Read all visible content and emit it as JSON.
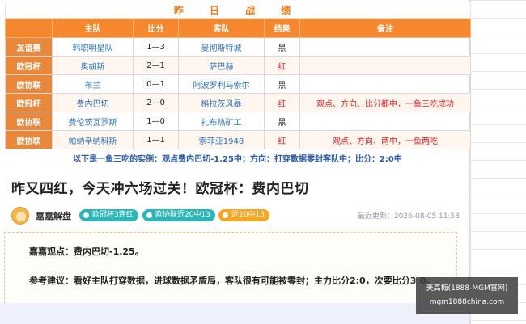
{
  "table": {
    "title": "昨 日 战 绩",
    "headers": {
      "home": "主队",
      "score": "比分",
      "away": "客队",
      "result": "结果",
      "note": "备注"
    },
    "rows": [
      {
        "league": "友谊赛",
        "home": "韩职明星队",
        "score": "1—3",
        "away": "曼彻斯特城",
        "result": "黑",
        "result_color": "black",
        "note": ""
      },
      {
        "league": "欧冠杯",
        "home": "奥胡斯",
        "score": "2—1",
        "away": "萨巴赫",
        "result": "红",
        "result_color": "red",
        "note": ""
      },
      {
        "league": "欧协联",
        "home": "布兰",
        "score": "0—1",
        "away": "阿波罗利马索尔",
        "result": "黑",
        "result_color": "black",
        "note": ""
      },
      {
        "league": "欧冠杯",
        "home": "费内巴切",
        "score": "2—0",
        "away": "格拉茨风暴",
        "result": "红",
        "result_color": "red",
        "note": "观点、方向、比分都中，一鱼三吃成功"
      },
      {
        "league": "欧协联",
        "home": "费伦茨瓦罗斯",
        "score": "1—0",
        "away": "扎布热矿工",
        "result": "黑",
        "result_color": "black",
        "note": ""
      },
      {
        "league": "欧协联",
        "home": "帕纳辛纳科斯",
        "score": "1—1",
        "away": "索菲亚1948",
        "result": "红",
        "result_color": "red",
        "note": "观点、方向、两中，一鱼两吃"
      }
    ],
    "example_line": "以下是一鱼三吃的实例：观点费内巴切-1.25中；方向：打穿数据零封客队中；比分：2:0中"
  },
  "article": {
    "headline": "昨又四红，今天冲六场过关！欧冠杯：费内巴切",
    "author": "嘉嘉解盘",
    "badges": [
      {
        "label": "欧冠杯3连红",
        "icon": "check-icon",
        "color": "#2ab6b6"
      },
      {
        "label": "欧协联近20中13",
        "icon": "check-icon",
        "color": "#2ab6b6"
      },
      {
        "label": "近20中13",
        "icon": "star-icon",
        "color": "#f5a623"
      }
    ],
    "update_label": "最近更新：",
    "update_time": "2026-08-05 11:58",
    "paragraphs": [
      "嘉嘉观点：费内巴切-1.25。",
      "参考建议：看好主队打穿数据，进球数据矛盾局，客队很有可能被零封；主力比分2:0，次要比分3:0。"
    ]
  },
  "watermark": {
    "line1": "美高梅(1888-MGM官网)",
    "line2": "mgm1888china.com"
  },
  "colors": {
    "accent_orange": "#f5882f",
    "league_bg": "#e9883b",
    "red": "#e02020",
    "link_blue": "#2a6fb9"
  }
}
